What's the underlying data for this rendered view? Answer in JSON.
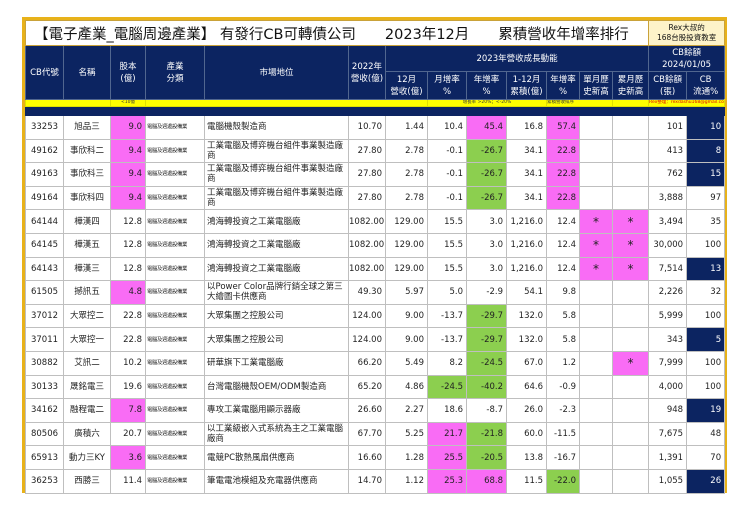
{
  "title": {
    "main": "【電子產業_電腦周邊產業】 有發行CB可轉債公司　　2023年12月　　累積營收年增率排行",
    "rex_line1": "Rex大叔的",
    "rex_line2": "168台股投資教室"
  },
  "headers": {
    "code": "CB代號",
    "name": "名稱",
    "capital": "股本\n(億)",
    "industry": "產業\n分類",
    "position": "市場地位",
    "rev2022": "2022年\n營收(億)",
    "group": "2023年營收成長動能",
    "cb_group": "CB餘額\n2024/01/05",
    "dec_rev": "12月\n營收(億)",
    "mom": "月增率\n%",
    "yoy": "年增率\n%",
    "cum": "1-12月\n累積(億)",
    "cum_yoy": "年增率\n%",
    "month_high": "單月歷\n史新高",
    "cum_high": "累月歷\n史新高",
    "cb_bal": "CB餘額\n(張)",
    "cb_float": "CB\n流通%"
  },
  "notes": {
    "capital": "<10億",
    "growth": "增長率 >20%；<-20%",
    "cum": "累積營收排序",
    "author": "Rex整理：rexdashu168@gmail.com"
  },
  "colors": {
    "pink": "#f96cf5",
    "green": "#8ccf4f",
    "navy": "#0c2461",
    "gold": "#e8b21a"
  },
  "rows": [
    {
      "code": "33253",
      "name": "旭品三",
      "capital": "9.0",
      "industry": "電腦及週邊設備業",
      "position": "電腦機殼製造商",
      "rev2022": "10.70",
      "dec_rev": "1.44",
      "mom": "10.4",
      "yoy": "45.4",
      "cum": "16.8",
      "cum_yoy": "57.4",
      "month_high": "",
      "cum_high": "",
      "cb_bal": "101",
      "cb_float": "10",
      "hl": {
        "capital": "pink",
        "yoy": "pink",
        "cum_yoy": "pink",
        "cb_float": "navy"
      }
    },
    {
      "code": "49162",
      "name": "事欣科二",
      "capital": "9.4",
      "industry": "電腦及週邊設備業",
      "position": "工業電腦及博弈機台組件事業製造廠商",
      "rev2022": "27.80",
      "dec_rev": "2.78",
      "mom": "-0.1",
      "yoy": "-26.7",
      "cum": "34.1",
      "cum_yoy": "22.8",
      "month_high": "",
      "cum_high": "",
      "cb_bal": "413",
      "cb_float": "8",
      "hl": {
        "capital": "pink",
        "yoy": "green",
        "cum_yoy": "pink",
        "cb_float": "navy"
      }
    },
    {
      "code": "49163",
      "name": "事欣科三",
      "capital": "9.4",
      "industry": "電腦及週邊設備業",
      "position": "工業電腦及博弈機台組件事業製造廠商",
      "rev2022": "27.80",
      "dec_rev": "2.78",
      "mom": "-0.1",
      "yoy": "-26.7",
      "cum": "34.1",
      "cum_yoy": "22.8",
      "month_high": "",
      "cum_high": "",
      "cb_bal": "762",
      "cb_float": "15",
      "hl": {
        "capital": "pink",
        "yoy": "green",
        "cum_yoy": "pink",
        "cb_float": "navy"
      }
    },
    {
      "code": "49164",
      "name": "事欣科四",
      "capital": "9.4",
      "industry": "電腦及週邊設備業",
      "position": "工業電腦及博弈機台組件事業製造廠商",
      "rev2022": "27.80",
      "dec_rev": "2.78",
      "mom": "-0.1",
      "yoy": "-26.7",
      "cum": "34.1",
      "cum_yoy": "22.8",
      "month_high": "",
      "cum_high": "",
      "cb_bal": "3,888",
      "cb_float": "97",
      "hl": {
        "capital": "pink",
        "yoy": "green",
        "cum_yoy": "pink"
      }
    },
    {
      "code": "64144",
      "name": "樺漢四",
      "capital": "12.8",
      "industry": "電腦及週邊設備業",
      "position": "鴻海轉投資之工業電腦廠",
      "rev2022": "1082.00",
      "dec_rev": "129.00",
      "mom": "15.5",
      "yoy": "3.0",
      "cum": "1,216.0",
      "cum_yoy": "12.4",
      "month_high": "*",
      "cum_high": "*",
      "cb_bal": "3,494",
      "cb_float": "35",
      "hl": {
        "month_high": "pink",
        "cum_high": "pink"
      }
    },
    {
      "code": "64145",
      "name": "樺漢五",
      "capital": "12.8",
      "industry": "電腦及週邊設備業",
      "position": "鴻海轉投資之工業電腦廠",
      "rev2022": "1082.00",
      "dec_rev": "129.00",
      "mom": "15.5",
      "yoy": "3.0",
      "cum": "1,216.0",
      "cum_yoy": "12.4",
      "month_high": "*",
      "cum_high": "*",
      "cb_bal": "30,000",
      "cb_float": "100",
      "hl": {
        "month_high": "pink",
        "cum_high": "pink"
      }
    },
    {
      "code": "64143",
      "name": "樺漢三",
      "capital": "12.8",
      "industry": "電腦及週邊設備業",
      "position": "鴻海轉投資之工業電腦廠",
      "rev2022": "1082.00",
      "dec_rev": "129.00",
      "mom": "15.5",
      "yoy": "3.0",
      "cum": "1,216.0",
      "cum_yoy": "12.4",
      "month_high": "*",
      "cum_high": "*",
      "cb_bal": "7,514",
      "cb_float": "13",
      "hl": {
        "month_high": "pink",
        "cum_high": "pink",
        "cb_float": "navy"
      }
    },
    {
      "code": "61505",
      "name": "撼訊五",
      "capital": "4.8",
      "industry": "電腦及週邊設備業",
      "position": "以Power Color品牌行銷全球之第三大繪圖卡供應商",
      "rev2022": "49.30",
      "dec_rev": "5.97",
      "mom": "5.0",
      "yoy": "-2.9",
      "cum": "54.1",
      "cum_yoy": "9.8",
      "month_high": "",
      "cum_high": "",
      "cb_bal": "2,226",
      "cb_float": "32",
      "hl": {
        "capital": "pink"
      }
    },
    {
      "code": "37012",
      "name": "大眾控二",
      "capital": "22.8",
      "industry": "電腦及週邊設備業",
      "position": "大眾集團之控股公司",
      "rev2022": "124.00",
      "dec_rev": "9.00",
      "mom": "-13.7",
      "yoy": "-29.7",
      "cum": "132.0",
      "cum_yoy": "5.8",
      "month_high": "",
      "cum_high": "",
      "cb_bal": "5,999",
      "cb_float": "100",
      "hl": {
        "yoy": "green"
      }
    },
    {
      "code": "37011",
      "name": "大眾控一",
      "capital": "22.8",
      "industry": "電腦及週邊設備業",
      "position": "大眾集團之控股公司",
      "rev2022": "124.00",
      "dec_rev": "9.00",
      "mom": "-13.7",
      "yoy": "-29.7",
      "cum": "132.0",
      "cum_yoy": "5.8",
      "month_high": "",
      "cum_high": "",
      "cb_bal": "343",
      "cb_float": "5",
      "hl": {
        "yoy": "green",
        "cb_float": "navy"
      }
    },
    {
      "code": "30882",
      "name": "艾訊二",
      "capital": "10.2",
      "industry": "電腦及週邊設備業",
      "position": "研華旗下工業電腦廠",
      "rev2022": "66.20",
      "dec_rev": "5.49",
      "mom": "8.2",
      "yoy": "-24.5",
      "cum": "67.0",
      "cum_yoy": "1.2",
      "month_high": "",
      "cum_high": "*",
      "cb_bal": "7,999",
      "cb_float": "100",
      "hl": {
        "yoy": "green",
        "cum_high": "pink"
      }
    },
    {
      "code": "30133",
      "name": "晟銘電三",
      "capital": "19.6",
      "industry": "電腦及週邊設備業",
      "position": "台灣電腦機殼OEM/ODM製造商",
      "rev2022": "65.20",
      "dec_rev": "4.86",
      "mom": "-24.5",
      "yoy": "-40.2",
      "cum": "64.6",
      "cum_yoy": "-0.9",
      "month_high": "",
      "cum_high": "",
      "cb_bal": "4,000",
      "cb_float": "100",
      "hl": {
        "mom": "green",
        "yoy": "green"
      }
    },
    {
      "code": "34162",
      "name": "融程電二",
      "capital": "7.8",
      "industry": "電腦及週邊設備業",
      "position": "專攻工業電腦用顯示器廠",
      "rev2022": "26.60",
      "dec_rev": "2.27",
      "mom": "18.6",
      "yoy": "-8.7",
      "cum": "26.0",
      "cum_yoy": "-2.3",
      "month_high": "",
      "cum_high": "",
      "cb_bal": "948",
      "cb_float": "19",
      "hl": {
        "capital": "pink",
        "cb_float": "navy"
      }
    },
    {
      "code": "80506",
      "name": "廣積六",
      "capital": "20.7",
      "industry": "電腦及週邊設備業",
      "position": "以工業級嵌入式系統為主之工業電腦廠商",
      "rev2022": "67.70",
      "dec_rev": "5.25",
      "mom": "21.7",
      "yoy": "-21.8",
      "cum": "60.0",
      "cum_yoy": "-11.5",
      "month_high": "",
      "cum_high": "",
      "cb_bal": "7,675",
      "cb_float": "48",
      "hl": {
        "mom": "pink",
        "yoy": "green"
      }
    },
    {
      "code": "65913",
      "name": "動力三KY",
      "capital": "3.6",
      "industry": "電腦及週邊設備業",
      "position": "電競PC散熱風扇供應商",
      "rev2022": "16.60",
      "dec_rev": "1.28",
      "mom": "25.5",
      "yoy": "-20.5",
      "cum": "13.8",
      "cum_yoy": "-16.7",
      "month_high": "",
      "cum_high": "",
      "cb_bal": "1,391",
      "cb_float": "70",
      "hl": {
        "capital": "pink",
        "mom": "pink",
        "yoy": "green"
      }
    },
    {
      "code": "36253",
      "name": "西勝三",
      "capital": "11.4",
      "industry": "電腦及週邊設備業",
      "position": "筆電電池模組及充電器供應商",
      "rev2022": "14.70",
      "dec_rev": "1.12",
      "mom": "25.3",
      "yoy": "68.8",
      "cum": "11.5",
      "cum_yoy": "-22.0",
      "month_high": "",
      "cum_high": "",
      "cb_bal": "1,055",
      "cb_float": "26",
      "hl": {
        "mom": "pink",
        "yoy": "pink",
        "cum_yoy": "green",
        "cb_float": "navy"
      }
    }
  ]
}
